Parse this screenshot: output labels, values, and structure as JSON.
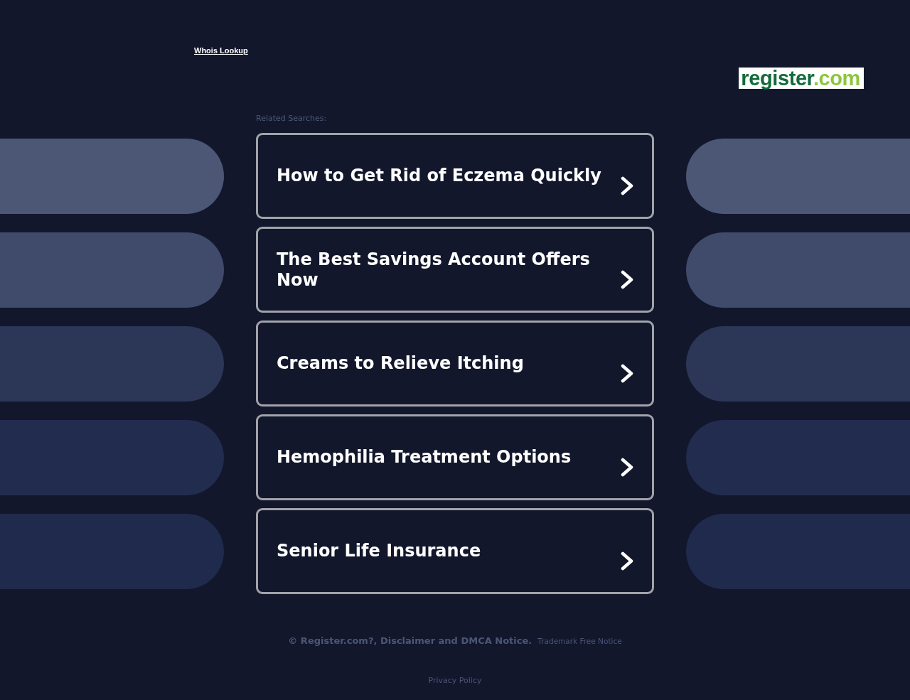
{
  "header": {
    "link": "Whois Lookup"
  },
  "logo": {
    "name": "register",
    "suffix": ".com"
  },
  "related": {
    "heading": "Related Searches:",
    "items": [
      {
        "label": "How to Get Rid of Eczema Quickly"
      },
      {
        "label": "The Best Savings Account Offers Now"
      },
      {
        "label": "Creams to Relieve Itching"
      },
      {
        "label": "Hemophilia Treatment Options"
      },
      {
        "label": "Senior Life Insurance"
      }
    ]
  },
  "footer": {
    "notice": "© Register.com?, Disclaimer and DMCA Notice.",
    "trademark": "Trademark Free Notice",
    "privacy": "Privacy Policy"
  }
}
